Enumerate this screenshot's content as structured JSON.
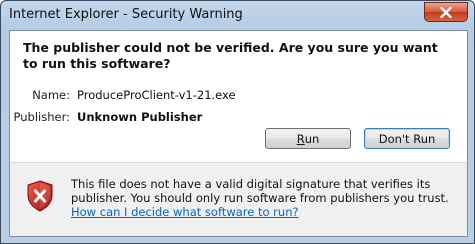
{
  "window": {
    "title": "Internet Explorer - Security Warning"
  },
  "dialog": {
    "heading": "The publisher could not be verified.  Are you sure you want to run this software?",
    "name_label": "Name:",
    "name_value": "ProduceProClient-v1-21.exe",
    "publisher_label": "Publisher:",
    "publisher_value": "Unknown Publisher",
    "run_button_pre": "",
    "run_button_mnemonic": "R",
    "run_button_post": "un",
    "dont_run_button": "Don't Run"
  },
  "warning": {
    "icon": "shield-error-icon",
    "text": "This file does not have a valid digital signature that verifies its publisher. You should only run software from publishers you trust.",
    "link": "How can I decide what software to run?"
  },
  "colors": {
    "link": "#0066cc",
    "close_button": "#c94a2b",
    "shield_red": "#c8201a"
  }
}
